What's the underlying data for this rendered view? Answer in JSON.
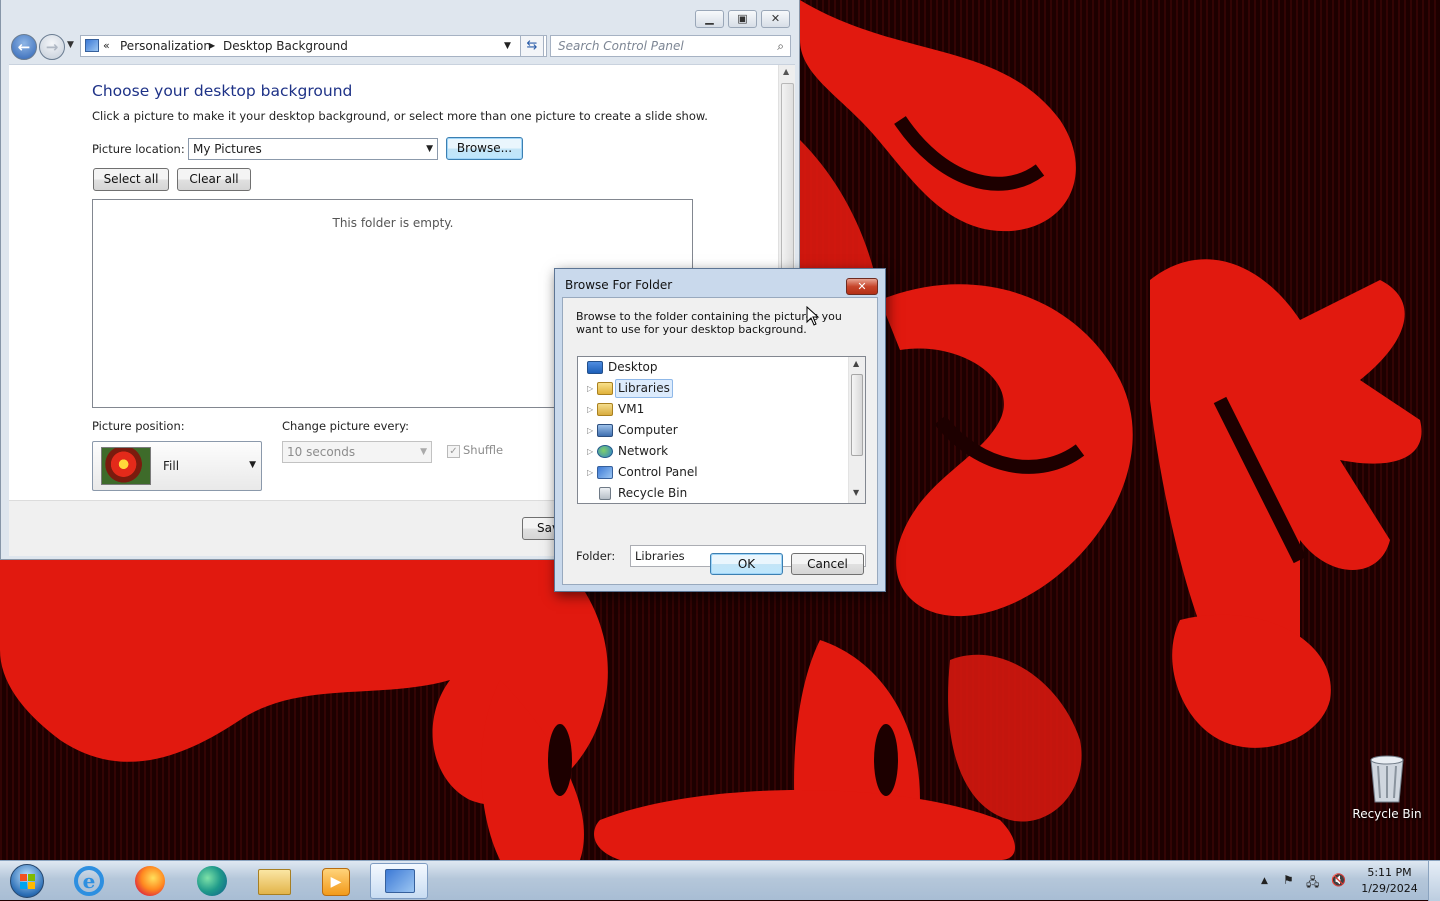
{
  "control_panel": {
    "breadcrumb_chevron": "«",
    "breadcrumb": [
      "Personalization",
      "Desktop Background"
    ],
    "search_placeholder": "Search Control Panel",
    "heading": "Choose your desktop background",
    "instructions": "Click a picture to make it your desktop background, or select more than one picture to create a slide show.",
    "picture_location_label": "Picture location:",
    "picture_location_value": "My Pictures",
    "browse_label": "Browse...",
    "select_all_label": "Select all",
    "clear_all_label": "Clear all",
    "empty_message": "This folder is empty.",
    "picture_position_label": "Picture position:",
    "picture_position_value": "Fill",
    "change_every_label": "Change picture every:",
    "change_every_value": "10 seconds",
    "shuffle_label": "Shuffle",
    "save_label_partial": "Sav"
  },
  "browse_dialog": {
    "title": "Browse For Folder",
    "instructions": "Browse to the folder containing the pictures you want to use for your desktop background.",
    "tree": [
      {
        "label": "Desktop",
        "icon": "desktop-icon",
        "expandable": false,
        "selected": false
      },
      {
        "label": "Libraries",
        "icon": "libraries-icon",
        "expandable": true,
        "selected": true
      },
      {
        "label": "VM1",
        "icon": "user-folder-icon",
        "expandable": true,
        "selected": false
      },
      {
        "label": "Computer",
        "icon": "computer-icon",
        "expandable": true,
        "selected": false
      },
      {
        "label": "Network",
        "icon": "network-icon",
        "expandable": true,
        "selected": false
      },
      {
        "label": "Control Panel",
        "icon": "control-panel-icon",
        "expandable": true,
        "selected": false
      },
      {
        "label": "Recycle Bin",
        "icon": "recycle-bin-icon",
        "expandable": false,
        "selected": false
      }
    ],
    "folder_label": "Folder:",
    "folder_value": "Libraries",
    "ok_label": "OK",
    "cancel_label": "Cancel"
  },
  "desktop": {
    "recycle_bin_label": "Recycle Bin"
  },
  "taskbar": {
    "items": [
      "start-orb",
      "internet-explorer",
      "firefox",
      "edge-legacy",
      "file-explorer",
      "media-player",
      "control-panel"
    ],
    "active_item": "control-panel",
    "time": "5:11 PM",
    "date": "1/29/2024"
  },
  "colors": {
    "heading_blue": "#1e3287",
    "wallpaper_red": "#e1190f",
    "wallpaper_dark": "#200000"
  }
}
